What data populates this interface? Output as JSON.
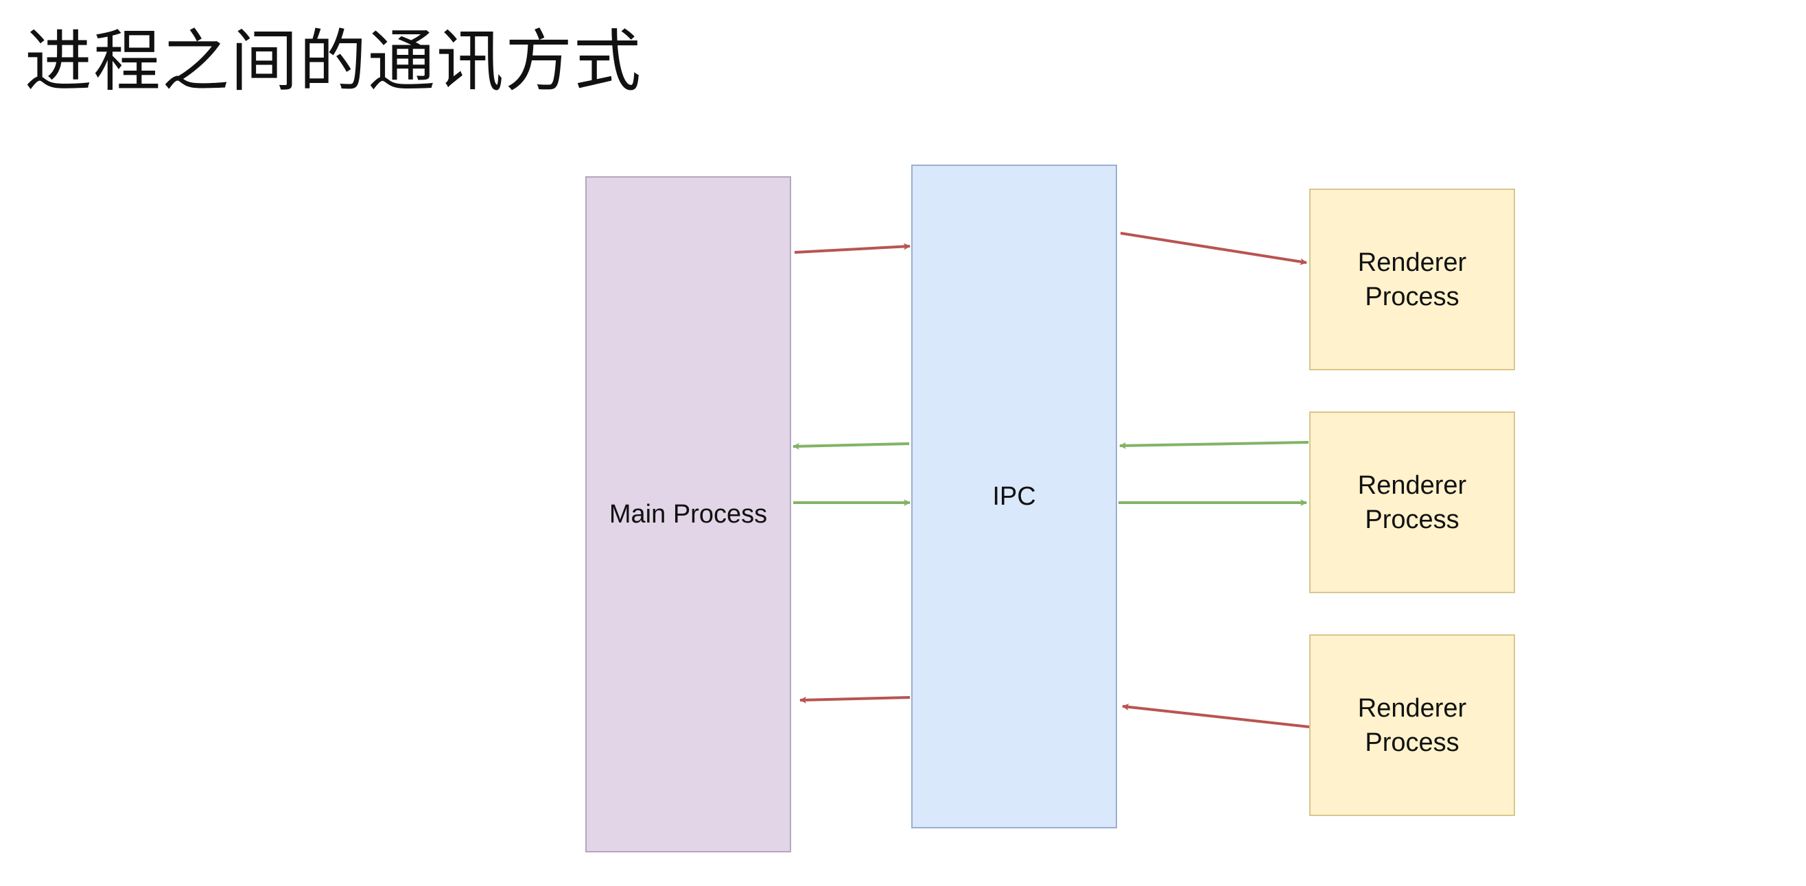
{
  "title": "进程之间的通讯方式",
  "diagram": {
    "main_label": "Main Process",
    "ipc_label": "IPC",
    "renderers": [
      {
        "line1": "Renderer",
        "line2": "Process"
      },
      {
        "line1": "Renderer",
        "line2": "Process"
      },
      {
        "line1": "Renderer",
        "line2": "Process"
      }
    ]
  },
  "colors": {
    "main_fill": "#e1d5e7",
    "ipc_fill": "#dae8fc",
    "renderer_fill": "#fff2cc",
    "arrow_red": "#b85450",
    "arrow_green": "#82b366"
  }
}
